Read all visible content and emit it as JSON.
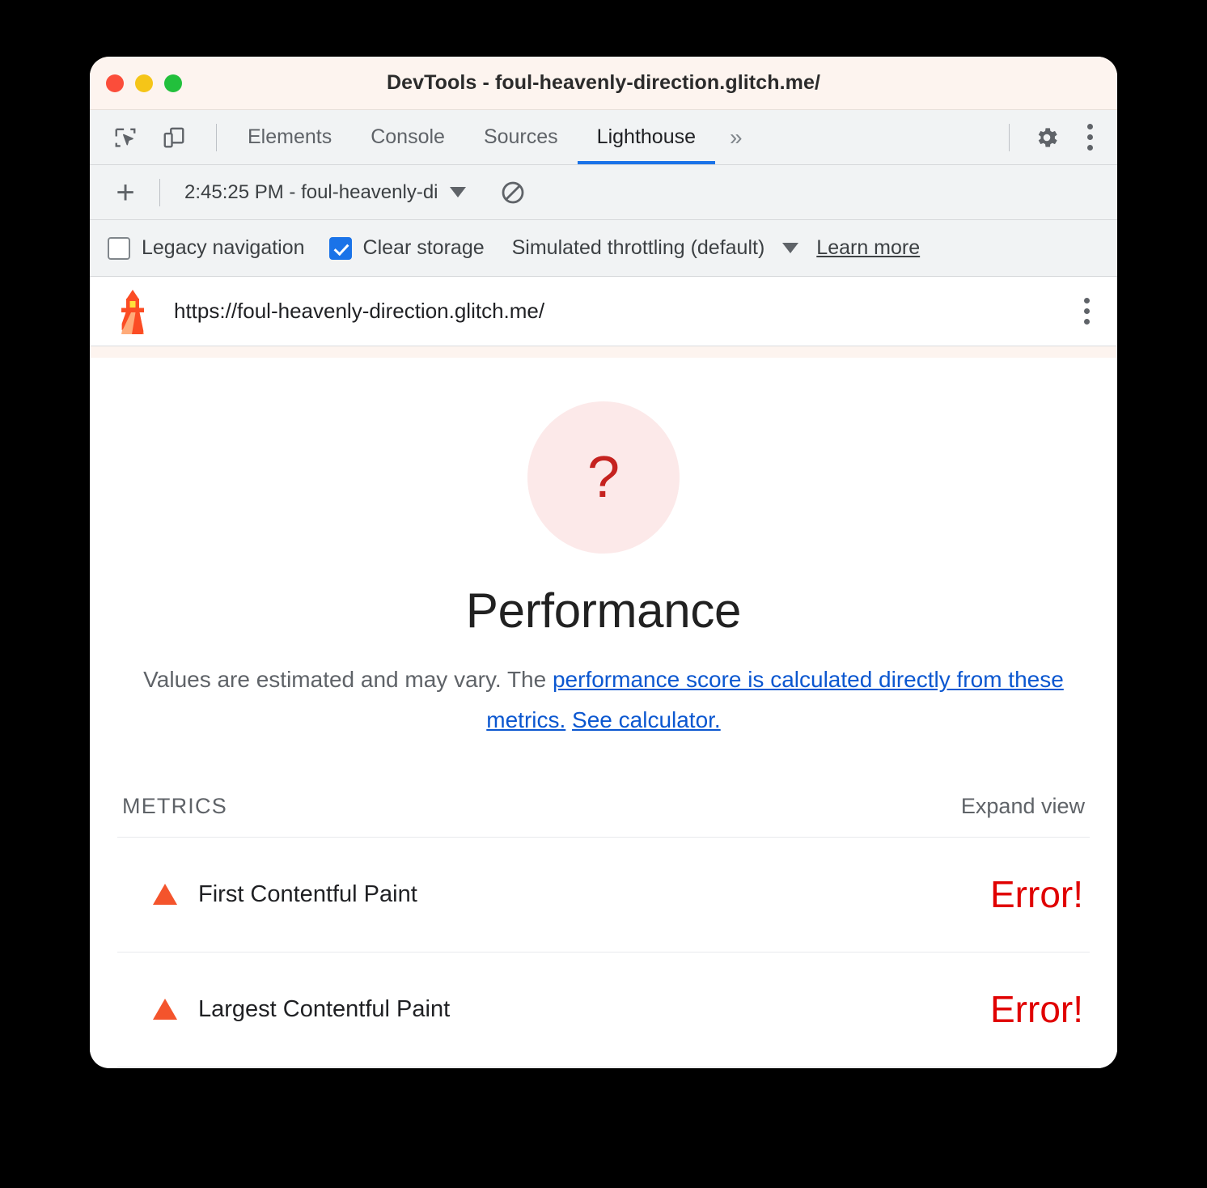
{
  "window": {
    "title": "DevTools - foul-heavenly-direction.glitch.me/",
    "traffic_lights": [
      "close",
      "minimize",
      "maximize"
    ]
  },
  "devtools_toolbar": {
    "inspect_icon": "inspect-element-icon",
    "device_icon": "device-toolbar-icon",
    "tabs": [
      {
        "label": "Elements",
        "active": false
      },
      {
        "label": "Console",
        "active": false
      },
      {
        "label": "Sources",
        "active": false
      },
      {
        "label": "Lighthouse",
        "active": true
      }
    ],
    "more_tabs": "»",
    "settings_icon": "gear-icon",
    "kebab_icon": "more-options-icon"
  },
  "run_toolbar": {
    "new_report_label": "+",
    "selected_run": "2:45:25 PM - foul-heavenly-di",
    "dropdown_icon": "chevron-down-icon",
    "clear_icon": "clear-all-icon"
  },
  "settings_row": {
    "legacy_navigation": {
      "label": "Legacy navigation",
      "checked": false
    },
    "clear_storage": {
      "label": "Clear storage",
      "checked": true
    },
    "throttling": {
      "label": "Simulated throttling (default)",
      "dropdown_icon": "chevron-down-icon"
    },
    "learn_more": "Learn more"
  },
  "url_bar": {
    "logo": "lighthouse-icon",
    "url": "https://foul-heavenly-direction.glitch.me/",
    "kebab": "report-options-icon"
  },
  "report": {
    "gauge": {
      "value": "?",
      "color": "#c5221f",
      "bg": "#fce9e9"
    },
    "category_title": "Performance",
    "description": {
      "part1": "Values are estimated and may vary. The ",
      "link1": "performance score is calculated directly from these metrics.",
      "part2": " ",
      "link2": "See calculator."
    },
    "metrics_header": "METRICS",
    "expand_view": "Expand view",
    "metrics": [
      {
        "icon": "warning-triangle-icon",
        "name": "First Contentful Paint",
        "value": "Error!"
      },
      {
        "icon": "warning-triangle-icon",
        "name": "Largest Contentful Paint",
        "value": "Error!"
      }
    ]
  },
  "colors": {
    "accent": "#1a73e8",
    "link": "#0b57d0",
    "error": "#e00000",
    "warning": "#f4542c",
    "titlebar_bg": "#fdf4ef"
  }
}
